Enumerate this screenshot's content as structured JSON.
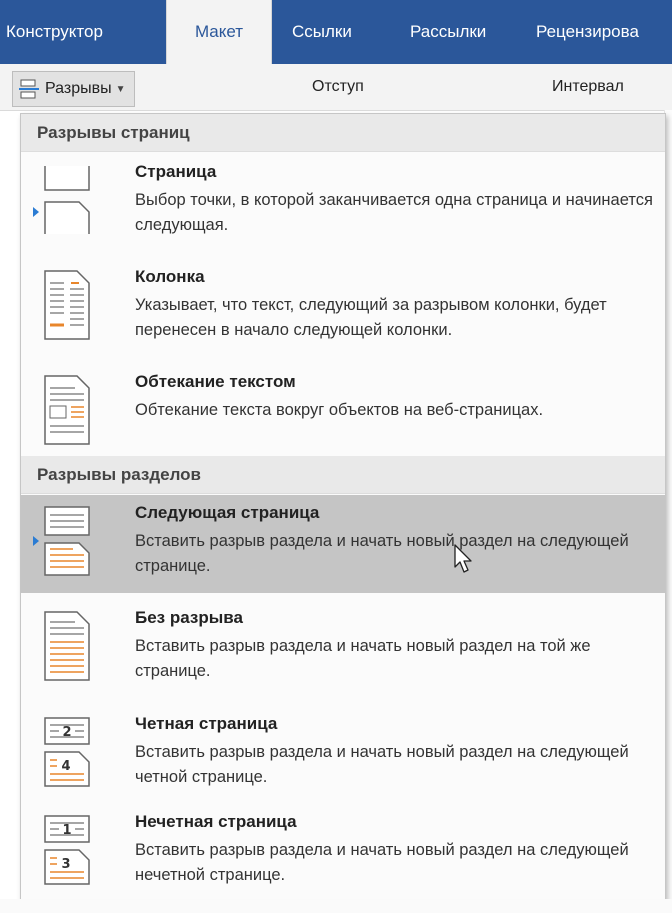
{
  "tabs": [
    {
      "label": "Конструктор"
    },
    {
      "label": "Макет"
    },
    {
      "label": "Ссылки"
    },
    {
      "label": "Рассылки"
    },
    {
      "label": "Рецензирова"
    }
  ],
  "ribbon": {
    "breaks_label": "Разрывы",
    "indent_label": "Отступ",
    "spacing_label": "Интервал"
  },
  "menu": {
    "page_breaks_header": "Разрывы страниц",
    "section_breaks_header": "Разрывы разделов",
    "items": [
      {
        "title": "Страница",
        "desc": "Выбор точки, в которой заканчивается одна страница и начинается следующая.",
        "icon": "page-break-icon"
      },
      {
        "title": "Колонка",
        "desc": "Указывает, что текст, следующий за разрывом колонки, будет перенесен в начало следующей колонки.",
        "icon": "column-break-icon"
      },
      {
        "title": "Обтекание текстом",
        "desc": "Обтекание текста вокруг объектов на веб-страницах.",
        "icon": "text-wrapping-icon"
      },
      {
        "title": "Следующая страница",
        "desc": "Вставить разрыв раздела и начать новый раздел на следующей странице.",
        "icon": "next-page-icon",
        "highlighted": true
      },
      {
        "title": "Без разрыва",
        "desc": "Вставить разрыв раздела и начать новый раздел на той же странице.",
        "icon": "continuous-icon"
      },
      {
        "title": "Четная страница",
        "desc": "Вставить разрыв раздела и начать новый раздел на следующей четной странице.",
        "icon": "even-page-icon"
      },
      {
        "title": "Нечетная страница",
        "desc": "Вставить разрыв раздела и начать новый раздел на следующей нечетной странице.",
        "icon": "odd-page-icon"
      }
    ]
  },
  "colors": {
    "ribbon_blue": "#2b579a",
    "accent_orange": "#e8862b",
    "highlight": "#c5c5c5"
  }
}
